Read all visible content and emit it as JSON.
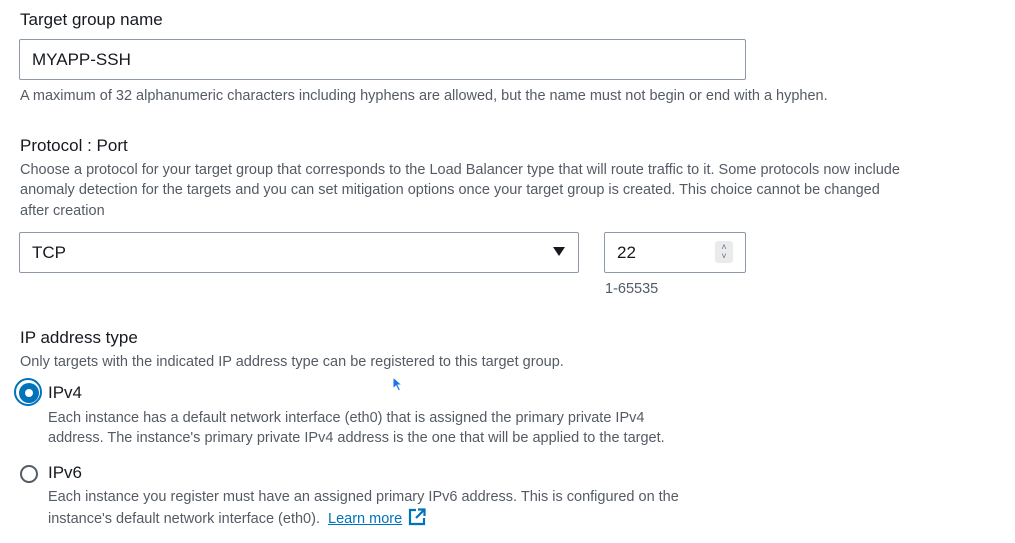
{
  "target_group_name": {
    "label": "Target group name",
    "value": "MYAPP-SSH",
    "hint": "A maximum of 32 alphanumeric characters including hyphens are allowed, but the name must not begin or end with a hyphen."
  },
  "protocol_port": {
    "label": "Protocol : Port",
    "description_line1": "Choose a protocol for your target group that corresponds to the Load Balancer type that will route traffic to it. Some protocols now include",
    "description_line2": "anomaly detection for the targets and you can set mitigation options once your target group is created. This choice cannot be changed",
    "description_line3": "after creation",
    "protocol_value": "TCP",
    "port_value": "22",
    "port_range_hint": "1-65535"
  },
  "ip_address_type": {
    "label": "IP address type",
    "description": "Only targets with the indicated IP address type can be registered to this target group.",
    "options": [
      {
        "label": "IPv4",
        "selected": true,
        "description_line1": "Each instance has a default network interface (eth0) that is assigned the primary private IPv4",
        "description_line2": "address. The instance's primary private IPv4 address is the one that will be applied to the target."
      },
      {
        "label": "IPv6",
        "selected": false,
        "description_line1": "Each instance you register must have an assigned primary IPv6 address. This is configured on the",
        "description_line2": "instance's default network interface (eth0).",
        "link_text": "Learn more"
      }
    ]
  },
  "colors": {
    "accent": "#0073bb",
    "text": "#16191f",
    "secondary_text": "#545b64",
    "border": "#8d99a8"
  }
}
